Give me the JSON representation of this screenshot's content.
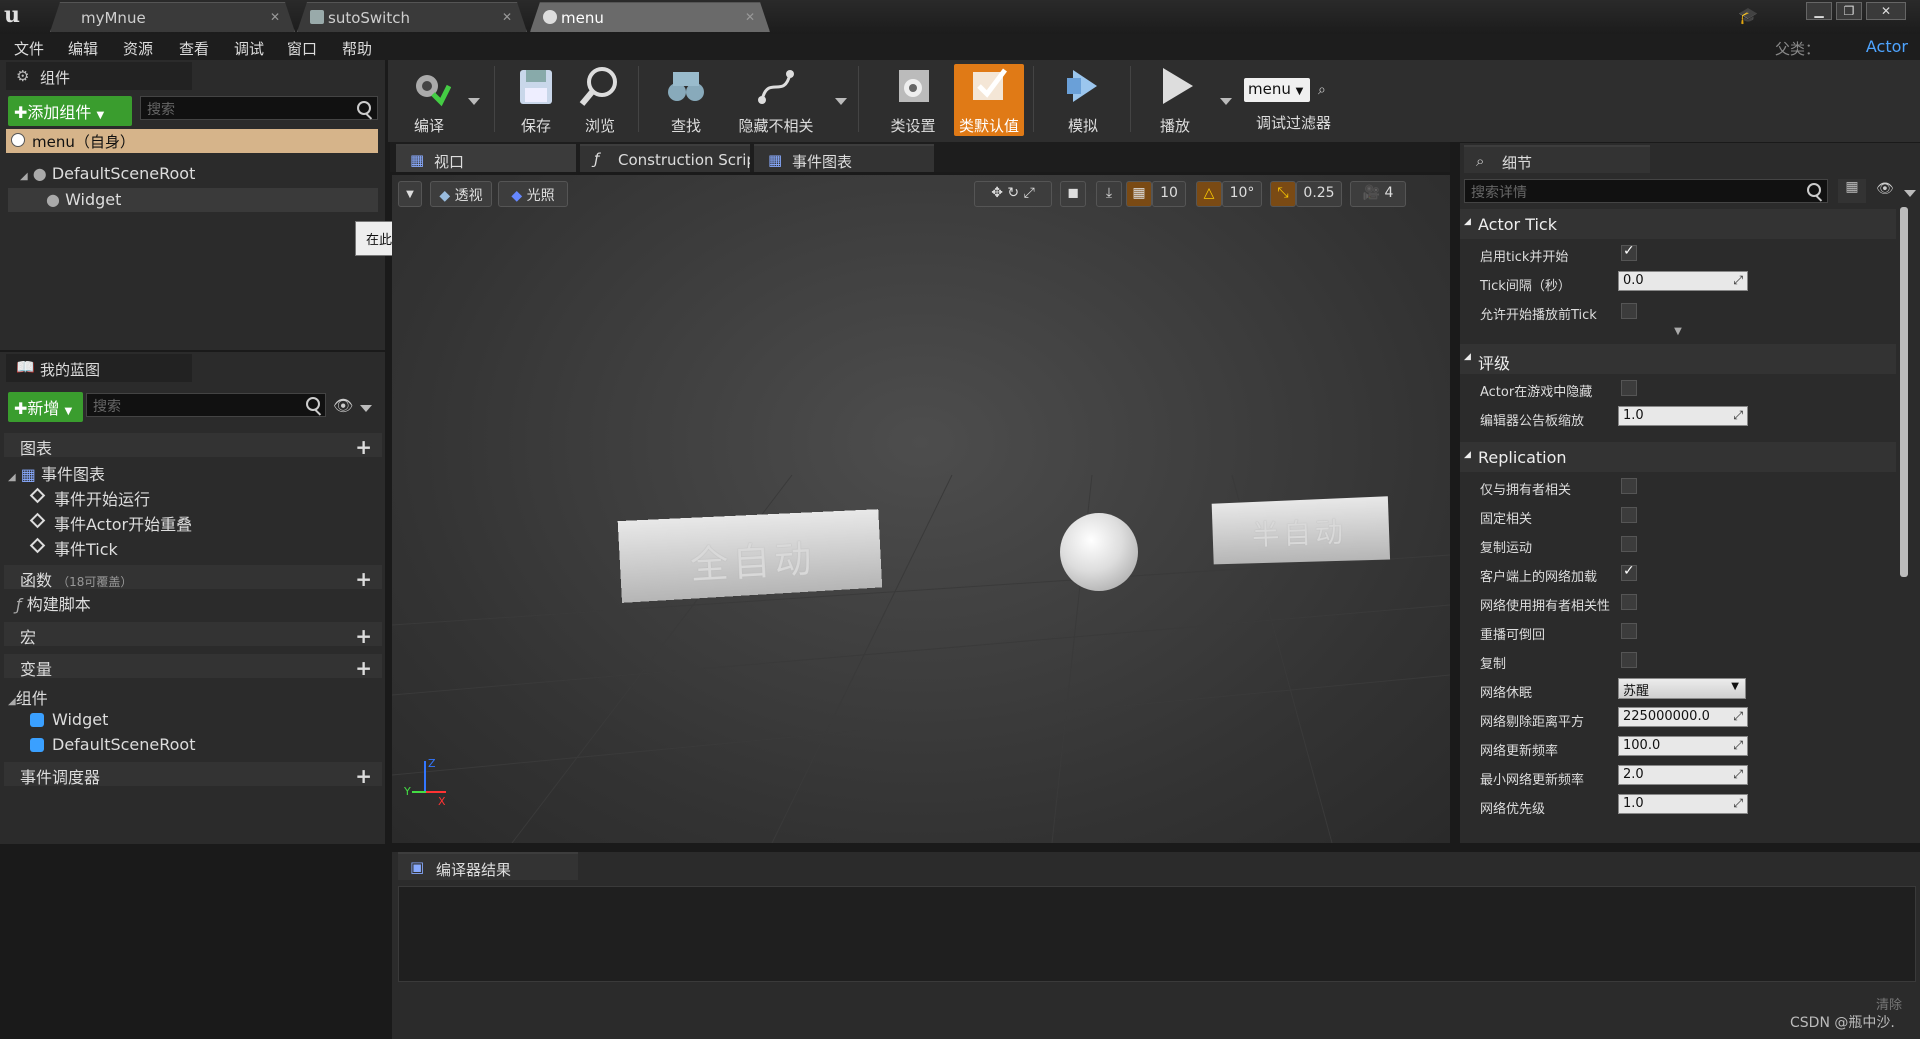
{
  "window": {
    "tabs": [
      {
        "label": "myMnue"
      },
      {
        "label": "sutoSwitch"
      },
      {
        "label": "menu"
      }
    ],
    "controls": {
      "minimize": "▁",
      "maximize": "❐",
      "close": "✕"
    }
  },
  "menubar": {
    "items": [
      "文件",
      "编辑",
      "资源",
      "查看",
      "调试",
      "窗口",
      "帮助"
    ],
    "parent_class_label": "父类：",
    "parent_class_value": "Actor"
  },
  "components_panel": {
    "title": "组件",
    "add_button": "✚添加组件",
    "search_placeholder": "搜索",
    "root_item": "menu（自身）",
    "tree": [
      "DefaultSceneRoot",
      "Widget"
    ]
  },
  "tooltip": "在此处放置资源添加组件。",
  "blueprint_panel": {
    "title": "我的蓝图",
    "new_button": "✚新增",
    "search_placeholder": "搜索",
    "sections": {
      "graphs": "图表",
      "event_graph": "事件图表",
      "events": [
        "事件开始运行",
        "事件Actor开始重叠",
        "事件Tick"
      ],
      "functions": "函数",
      "functions_note": "（18可覆盖）",
      "construction": "构建脚本",
      "macros": "宏",
      "variables": "变量",
      "components": "组件",
      "component_vars": [
        "Widget",
        "DefaultSceneRoot"
      ],
      "dispatchers": "事件调度器"
    }
  },
  "toolbar": {
    "buttons": [
      "编译",
      "保存",
      "浏览",
      "查找",
      "隐藏不相关",
      "类设置",
      "类默认值",
      "模拟",
      "播放"
    ],
    "debug_dropdown": "menu",
    "debug_filter": "调试过滤器"
  },
  "editor_tabs": [
    "视口",
    "Construction Scrip",
    "事件图表"
  ],
  "viewport": {
    "perspective": "透视",
    "lighting": "光照",
    "grid_snap": "10",
    "rotation_snap": "10°",
    "scale_snap": "0.25",
    "camera_speed": "4",
    "cards": [
      "全自动",
      "半自动"
    ],
    "axes": {
      "x": "X",
      "y": "Y",
      "z": "Z"
    }
  },
  "details": {
    "title": "细节",
    "search_placeholder": "搜索详情",
    "sections": [
      {
        "title": "Actor Tick",
        "rows": [
          {
            "label": "启用tick并开始",
            "type": "check",
            "value": true
          },
          {
            "label": "Tick间隔（秒）",
            "type": "field",
            "value": "0.0"
          },
          {
            "label": "允许开始播放前Tick",
            "type": "check",
            "value": false
          }
        ]
      },
      {
        "title": "评级",
        "rows": [
          {
            "label": "Actor在游戏中隐藏",
            "type": "check",
            "value": false
          },
          {
            "label": "编辑器公告板缩放",
            "type": "field",
            "value": "1.0"
          }
        ]
      },
      {
        "title": "Replication",
        "rows": [
          {
            "label": "仅与拥有者相关",
            "type": "check",
            "value": false
          },
          {
            "label": "固定相关",
            "type": "check",
            "value": false
          },
          {
            "label": "复制运动",
            "type": "check",
            "value": false
          },
          {
            "label": "客户端上的网络加载",
            "type": "check",
            "value": true
          },
          {
            "label": "网络使用拥有者相关性",
            "type": "check",
            "value": false
          },
          {
            "label": "重播可倒回",
            "type": "check",
            "value": false
          },
          {
            "label": "复制",
            "type": "check",
            "value": false
          },
          {
            "label": "网络休眠",
            "type": "dropdown",
            "value": "苏醒"
          },
          {
            "label": "网络剔除距离平方",
            "type": "field",
            "value": "225000000.0"
          },
          {
            "label": "网络更新频率",
            "type": "field",
            "value": "100.0"
          },
          {
            "label": "最小网络更新频率",
            "type": "field",
            "value": "2.0"
          },
          {
            "label": "网络优先级",
            "type": "field",
            "value": "1.0"
          }
        ]
      }
    ]
  },
  "compiler": {
    "title": "编译器结果",
    "clear": "清除",
    "watermark": "CSDN @瓶中沙."
  }
}
